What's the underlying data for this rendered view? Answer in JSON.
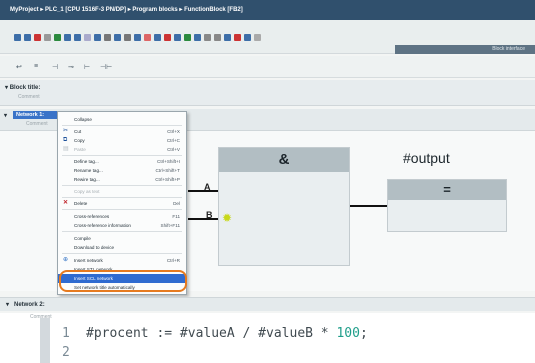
{
  "titlebar": {
    "path": "MyProject ▸ PLC_1 [CPU 1516F-3 PN/DP] ▸ Program blocks ▸ FunctionBlock [FB2]"
  },
  "toolbar1": {
    "right_label": "Block interface"
  },
  "toolbar2": {
    "icons": [
      "↩",
      "≡",
      "⊣",
      "⊸",
      "⊢",
      "⊣⊢"
    ]
  },
  "block": {
    "title": "Block title:",
    "comment": "Comment"
  },
  "network1": {
    "label": "Network 1:",
    "comment": "Comment"
  },
  "canvas": {
    "and_label": "&",
    "output_label": "#output",
    "eq_label": "=",
    "input_a": "A",
    "input_b": "B"
  },
  "context_menu": {
    "items": [
      {
        "label": "Collapse",
        "shortcut": "",
        "disabled": false,
        "icon": ""
      },
      {
        "label": "Cut",
        "shortcut": "Ctrl+X",
        "disabled": false,
        "icon": "cut-icon"
      },
      {
        "label": "Copy",
        "shortcut": "Ctrl+C",
        "disabled": false,
        "icon": "copy-icon"
      },
      {
        "label": "Paste",
        "shortcut": "Ctrl+V",
        "disabled": true,
        "icon": "paste-icon"
      },
      {
        "label": "Define tag...",
        "shortcut": "Ctrl+Shift+I",
        "disabled": false,
        "icon": ""
      },
      {
        "label": "Rename tag...",
        "shortcut": "Ctrl+Shift+T",
        "disabled": false,
        "icon": ""
      },
      {
        "label": "Rewire tag...",
        "shortcut": "Ctrl+Shift+P",
        "disabled": false,
        "icon": ""
      },
      {
        "label": "Copy as text",
        "shortcut": "",
        "disabled": true,
        "icon": ""
      },
      {
        "label": "Delete",
        "shortcut": "Del",
        "disabled": false,
        "icon": "delete-icon"
      },
      {
        "label": "Cross-references",
        "shortcut": "F11",
        "disabled": false,
        "icon": ""
      },
      {
        "label": "Cross-reference information",
        "shortcut": "Shift+F11",
        "disabled": false,
        "icon": ""
      },
      {
        "label": "Compile",
        "shortcut": "",
        "disabled": false,
        "icon": ""
      },
      {
        "label": "Download to device",
        "shortcut": "",
        "disabled": false,
        "icon": ""
      },
      {
        "label": "Insert network",
        "shortcut": "Ctrl+R",
        "disabled": false,
        "icon": "insert-network-icon"
      },
      {
        "label": "Insert STL network",
        "shortcut": "",
        "disabled": false,
        "icon": ""
      },
      {
        "label": "Insert SCL network",
        "shortcut": "",
        "disabled": false,
        "icon": "",
        "highlight": true
      },
      {
        "label": "Set network title automatically",
        "shortcut": "",
        "disabled": false,
        "icon": ""
      }
    ]
  },
  "network2": {
    "label": "Network 2:",
    "comment": "Comment"
  },
  "code": {
    "lines": [
      {
        "num": "1",
        "text": "#procent := #valueA / #valueB * ",
        "value": "100",
        "end": ";"
      },
      {
        "num": "2",
        "text": "",
        "value": "",
        "end": ""
      }
    ]
  }
}
